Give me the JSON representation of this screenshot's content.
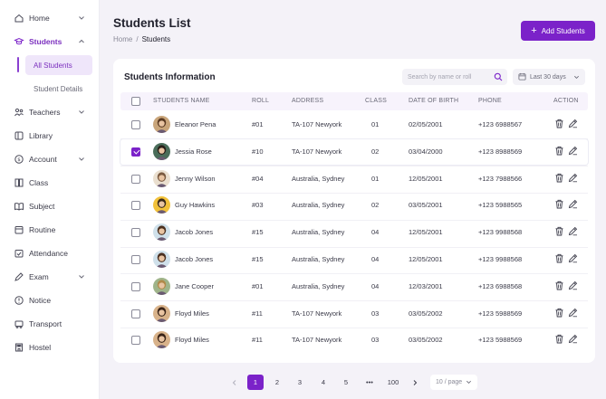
{
  "sidebar": {
    "items": [
      {
        "label": "Home",
        "icon": "home-icon",
        "has_chevron": true
      },
      {
        "label": "Students",
        "icon": "student-icon",
        "has_chevron": true,
        "active": true
      },
      {
        "label": "Teachers",
        "icon": "teachers-icon",
        "has_chevron": true
      },
      {
        "label": "Library",
        "icon": "library-icon",
        "has_chevron": false
      },
      {
        "label": "Account",
        "icon": "account-icon",
        "has_chevron": true
      },
      {
        "label": "Class",
        "icon": "class-icon",
        "has_chevron": false
      },
      {
        "label": "Subject",
        "icon": "subject-icon",
        "has_chevron": false
      },
      {
        "label": "Routine",
        "icon": "routine-icon",
        "has_chevron": false
      },
      {
        "label": "Attendance",
        "icon": "attendance-icon",
        "has_chevron": false
      },
      {
        "label": "Exam",
        "icon": "exam-icon",
        "has_chevron": true
      },
      {
        "label": "Notice",
        "icon": "notice-icon",
        "has_chevron": false
      },
      {
        "label": "Transport",
        "icon": "transport-icon",
        "has_chevron": false
      },
      {
        "label": "Hostel",
        "icon": "hostel-icon",
        "has_chevron": false
      }
    ],
    "students_sub": [
      {
        "label": "All Students",
        "active": true
      },
      {
        "label": "Student Details",
        "active": false
      }
    ]
  },
  "header": {
    "title": "Students List",
    "breadcrumb_home": "Home",
    "breadcrumb_sep": "/",
    "breadcrumb_current": "Students",
    "add_button": "Add Students"
  },
  "card": {
    "title": "Students Information",
    "search_placeholder": "Search by name or roll",
    "date_filter": "Last 30 days"
  },
  "table": {
    "columns": [
      "STUDENTS NAME",
      "ROLL",
      "ADDRESS",
      "CLASS",
      "DATE OF BIRTH",
      "PHONE",
      "ACTION"
    ],
    "rows": [
      {
        "name": "Eleanor Pena",
        "roll": "#01",
        "address": "TA-107 Newyork",
        "class": "01",
        "dob": "02/05/2001",
        "phone": "+123 6988567",
        "checked": false
      },
      {
        "name": "Jessia Rose",
        "roll": "#10",
        "address": "TA-107 Newyork",
        "class": "02",
        "dob": "03/04/2000",
        "phone": "+123 8988569",
        "checked": true
      },
      {
        "name": "Jenny Wilson",
        "roll": "#04",
        "address": "Australia, Sydney",
        "class": "01",
        "dob": "12/05/2001",
        "phone": "+123 7988566",
        "checked": false
      },
      {
        "name": "Guy Hawkins",
        "roll": "#03",
        "address": "Australia, Sydney",
        "class": "02",
        "dob": "03/05/2001",
        "phone": "+123 5988565",
        "checked": false
      },
      {
        "name": "Jacob Jones",
        "roll": "#15",
        "address": "Australia, Sydney",
        "class": "04",
        "dob": "12/05/2001",
        "phone": "+123 9988568",
        "checked": false
      },
      {
        "name": "Jacob Jones",
        "roll": "#15",
        "address": "Australia, Sydney",
        "class": "04",
        "dob": "12/05/2001",
        "phone": "+123 9988568",
        "checked": false
      },
      {
        "name": "Jane Cooper",
        "roll": "#01",
        "address": "Australia, Sydney",
        "class": "04",
        "dob": "12/03/2001",
        "phone": "+123 6988568",
        "checked": false
      },
      {
        "name": "Floyd Miles",
        "roll": "#11",
        "address": "TA-107 Newyork",
        "class": "03",
        "dob": "03/05/2002",
        "phone": "+123 5988569",
        "checked": false
      },
      {
        "name": "Floyd Miles",
        "roll": "#11",
        "address": "TA-107 Newyork",
        "class": "03",
        "dob": "03/05/2002",
        "phone": "+123 5988569",
        "checked": false
      }
    ]
  },
  "pagination": {
    "pages": [
      "1",
      "2",
      "3",
      "4",
      "5",
      "•••",
      "100"
    ],
    "current": "1",
    "per_page": "10 / page"
  },
  "colors": {
    "accent": "#7b22c9",
    "accent_light": "#efe6fa",
    "background": "#f4f2f8"
  }
}
